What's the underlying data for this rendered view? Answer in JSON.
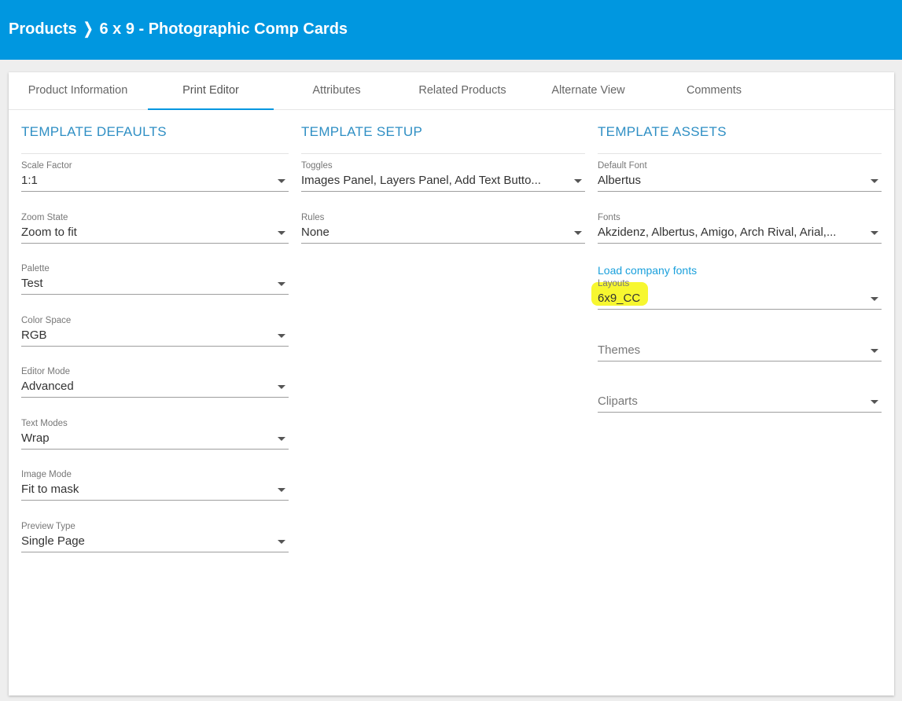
{
  "header": {
    "breadcrumb_root": "Products",
    "breadcrumb_separator": "❭",
    "breadcrumb_current": "6 x 9 - Photographic Comp Cards"
  },
  "tabs": [
    {
      "label": "Product Information"
    },
    {
      "label": "Print Editor"
    },
    {
      "label": "Attributes"
    },
    {
      "label": "Related Products"
    },
    {
      "label": "Alternate View"
    },
    {
      "label": "Comments"
    }
  ],
  "active_tab": "Print Editor",
  "template_defaults": {
    "title": "TEMPLATE DEFAULTS",
    "fields": [
      {
        "label": "Scale Factor",
        "value": "1:1"
      },
      {
        "label": "Zoom State",
        "value": "Zoom to fit"
      },
      {
        "label": "Palette",
        "value": "Test"
      },
      {
        "label": "Color Space",
        "value": "RGB"
      },
      {
        "label": "Editor Mode",
        "value": "Advanced"
      },
      {
        "label": "Text Modes",
        "value": "Wrap"
      },
      {
        "label": "Image Mode",
        "value": "Fit to mask"
      },
      {
        "label": "Preview Type",
        "value": "Single Page"
      }
    ]
  },
  "template_setup": {
    "title": "TEMPLATE SETUP",
    "fields": [
      {
        "label": "Toggles",
        "value": "Images Panel, Layers Panel, Add Text Butto..."
      },
      {
        "label": "Rules",
        "value": "None"
      }
    ]
  },
  "template_assets": {
    "title": "TEMPLATE ASSETS",
    "default_font": {
      "label": "Default Font",
      "value": "Albertus"
    },
    "fonts": {
      "label": "Fonts",
      "value": "Akzidenz, Albertus, Amigo, Arch Rival, Arial,..."
    },
    "load_fonts_link": "Load company fonts",
    "layouts": {
      "label": "Layouts",
      "value": "6x9_CC"
    },
    "themes": {
      "placeholder": "Themes"
    },
    "cliparts": {
      "placeholder": "Cliparts"
    }
  },
  "colors": {
    "header_bg": "#0097e0",
    "accent": "#0097e0",
    "section_title": "#2f8fc4",
    "highlight": "#f6f60c"
  }
}
